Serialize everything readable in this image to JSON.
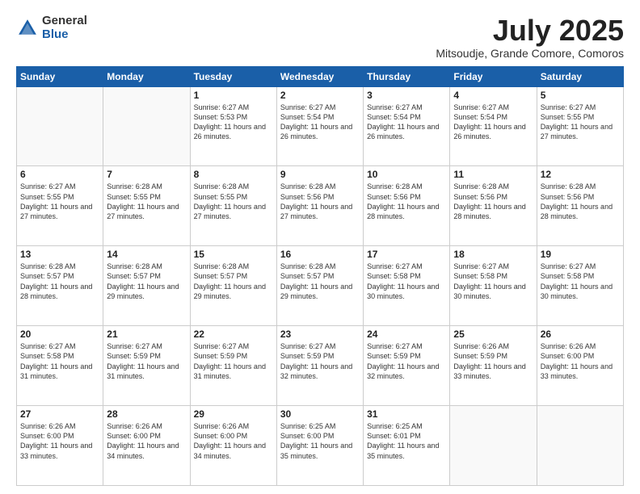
{
  "logo": {
    "general": "General",
    "blue": "Blue"
  },
  "header": {
    "month": "July 2025",
    "location": "Mitsoudje, Grande Comore, Comoros"
  },
  "days_of_week": [
    "Sunday",
    "Monday",
    "Tuesday",
    "Wednesday",
    "Thursday",
    "Friday",
    "Saturday"
  ],
  "weeks": [
    [
      {
        "num": "",
        "info": ""
      },
      {
        "num": "",
        "info": ""
      },
      {
        "num": "1",
        "info": "Sunrise: 6:27 AM\nSunset: 5:53 PM\nDaylight: 11 hours and 26 minutes."
      },
      {
        "num": "2",
        "info": "Sunrise: 6:27 AM\nSunset: 5:54 PM\nDaylight: 11 hours and 26 minutes."
      },
      {
        "num": "3",
        "info": "Sunrise: 6:27 AM\nSunset: 5:54 PM\nDaylight: 11 hours and 26 minutes."
      },
      {
        "num": "4",
        "info": "Sunrise: 6:27 AM\nSunset: 5:54 PM\nDaylight: 11 hours and 26 minutes."
      },
      {
        "num": "5",
        "info": "Sunrise: 6:27 AM\nSunset: 5:55 PM\nDaylight: 11 hours and 27 minutes."
      }
    ],
    [
      {
        "num": "6",
        "info": "Sunrise: 6:27 AM\nSunset: 5:55 PM\nDaylight: 11 hours and 27 minutes."
      },
      {
        "num": "7",
        "info": "Sunrise: 6:28 AM\nSunset: 5:55 PM\nDaylight: 11 hours and 27 minutes."
      },
      {
        "num": "8",
        "info": "Sunrise: 6:28 AM\nSunset: 5:55 PM\nDaylight: 11 hours and 27 minutes."
      },
      {
        "num": "9",
        "info": "Sunrise: 6:28 AM\nSunset: 5:56 PM\nDaylight: 11 hours and 27 minutes."
      },
      {
        "num": "10",
        "info": "Sunrise: 6:28 AM\nSunset: 5:56 PM\nDaylight: 11 hours and 28 minutes."
      },
      {
        "num": "11",
        "info": "Sunrise: 6:28 AM\nSunset: 5:56 PM\nDaylight: 11 hours and 28 minutes."
      },
      {
        "num": "12",
        "info": "Sunrise: 6:28 AM\nSunset: 5:56 PM\nDaylight: 11 hours and 28 minutes."
      }
    ],
    [
      {
        "num": "13",
        "info": "Sunrise: 6:28 AM\nSunset: 5:57 PM\nDaylight: 11 hours and 28 minutes."
      },
      {
        "num": "14",
        "info": "Sunrise: 6:28 AM\nSunset: 5:57 PM\nDaylight: 11 hours and 29 minutes."
      },
      {
        "num": "15",
        "info": "Sunrise: 6:28 AM\nSunset: 5:57 PM\nDaylight: 11 hours and 29 minutes."
      },
      {
        "num": "16",
        "info": "Sunrise: 6:28 AM\nSunset: 5:57 PM\nDaylight: 11 hours and 29 minutes."
      },
      {
        "num": "17",
        "info": "Sunrise: 6:27 AM\nSunset: 5:58 PM\nDaylight: 11 hours and 30 minutes."
      },
      {
        "num": "18",
        "info": "Sunrise: 6:27 AM\nSunset: 5:58 PM\nDaylight: 11 hours and 30 minutes."
      },
      {
        "num": "19",
        "info": "Sunrise: 6:27 AM\nSunset: 5:58 PM\nDaylight: 11 hours and 30 minutes."
      }
    ],
    [
      {
        "num": "20",
        "info": "Sunrise: 6:27 AM\nSunset: 5:58 PM\nDaylight: 11 hours and 31 minutes."
      },
      {
        "num": "21",
        "info": "Sunrise: 6:27 AM\nSunset: 5:59 PM\nDaylight: 11 hours and 31 minutes."
      },
      {
        "num": "22",
        "info": "Sunrise: 6:27 AM\nSunset: 5:59 PM\nDaylight: 11 hours and 31 minutes."
      },
      {
        "num": "23",
        "info": "Sunrise: 6:27 AM\nSunset: 5:59 PM\nDaylight: 11 hours and 32 minutes."
      },
      {
        "num": "24",
        "info": "Sunrise: 6:27 AM\nSunset: 5:59 PM\nDaylight: 11 hours and 32 minutes."
      },
      {
        "num": "25",
        "info": "Sunrise: 6:26 AM\nSunset: 5:59 PM\nDaylight: 11 hours and 33 minutes."
      },
      {
        "num": "26",
        "info": "Sunrise: 6:26 AM\nSunset: 6:00 PM\nDaylight: 11 hours and 33 minutes."
      }
    ],
    [
      {
        "num": "27",
        "info": "Sunrise: 6:26 AM\nSunset: 6:00 PM\nDaylight: 11 hours and 33 minutes."
      },
      {
        "num": "28",
        "info": "Sunrise: 6:26 AM\nSunset: 6:00 PM\nDaylight: 11 hours and 34 minutes."
      },
      {
        "num": "29",
        "info": "Sunrise: 6:26 AM\nSunset: 6:00 PM\nDaylight: 11 hours and 34 minutes."
      },
      {
        "num": "30",
        "info": "Sunrise: 6:25 AM\nSunset: 6:00 PM\nDaylight: 11 hours and 35 minutes."
      },
      {
        "num": "31",
        "info": "Sunrise: 6:25 AM\nSunset: 6:01 PM\nDaylight: 11 hours and 35 minutes."
      },
      {
        "num": "",
        "info": ""
      },
      {
        "num": "",
        "info": ""
      }
    ]
  ]
}
